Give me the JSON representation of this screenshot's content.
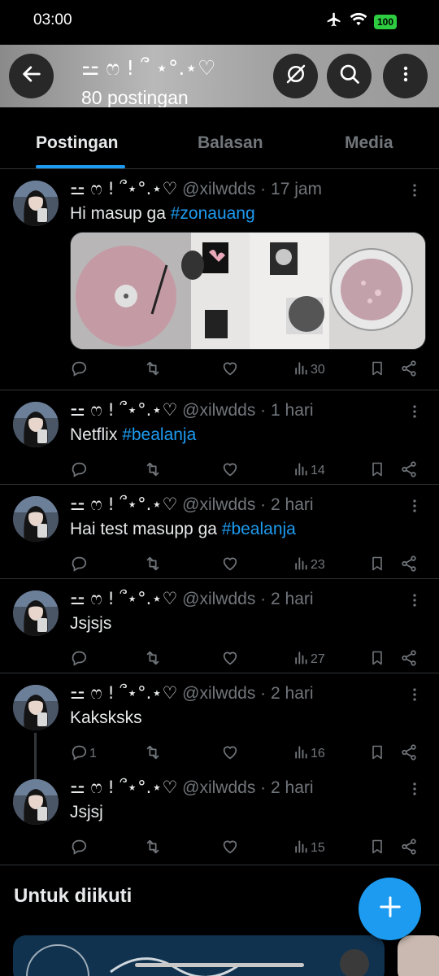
{
  "status_bar": {
    "time": "03:00",
    "battery": "100"
  },
  "header": {
    "name": "⚍ ෆ ! ՞ ⋆°.⋆♡",
    "post_count": "80 postingan"
  },
  "tabs": [
    {
      "label": "Postingan",
      "active": true
    },
    {
      "label": "Balasan",
      "active": false
    },
    {
      "label": "Media",
      "active": false
    }
  ],
  "posts": [
    {
      "name": "⚍ ෆ ! ՞⋆°.⋆♡",
      "handle": "@xilwdds",
      "time": "17 jam",
      "text": "Hi masup ga ",
      "hashtag": "#zonauang",
      "replies": "",
      "views": "30"
    },
    {
      "name": "⚍ ෆ ! ՞⋆°.⋆♡",
      "handle": "@xilwdds",
      "time": "1 hari",
      "text": "Netflix ",
      "hashtag": "#bealanja",
      "replies": "",
      "views": "14"
    },
    {
      "name": "⚍ ෆ ! ՞⋆°.⋆♡",
      "handle": "@xilwdds",
      "time": "2 hari",
      "text": "Hai test masupp ga ",
      "hashtag": "#bealanja",
      "replies": "",
      "views": "23"
    },
    {
      "name": "⚍ ෆ ! ՞⋆°.⋆♡",
      "handle": "@xilwdds",
      "time": "2 hari",
      "text": "Jsjsjs",
      "hashtag": "",
      "replies": "",
      "views": "27"
    },
    {
      "name": "⚍ ෆ ! ՞⋆°.⋆♡",
      "handle": "@xilwdds",
      "time": "2 hari",
      "text": "Kaksksks",
      "hashtag": "",
      "replies": "1",
      "views": "16"
    },
    {
      "name": "⚍ ෆ ! ՞⋆°.⋆♡",
      "handle": "@xilwdds",
      "time": "2 hari",
      "text": "Jsjsj",
      "hashtag": "",
      "replies": "",
      "views": "15"
    }
  ],
  "for_you": {
    "title": "Untuk diikuti"
  },
  "colors": {
    "accent": "#1d9bf0",
    "muted": "#71767b",
    "background": "#000000"
  },
  "icons": {
    "back": "arrow-left-icon",
    "hide": "eye-off-icon",
    "search": "search-icon",
    "more": "more-vertical-icon",
    "reply": "reply-icon",
    "repost": "repost-icon",
    "like": "heart-icon",
    "views": "views-icon",
    "bookmark": "bookmark-icon",
    "share": "share-icon",
    "compose": "plus-icon"
  }
}
